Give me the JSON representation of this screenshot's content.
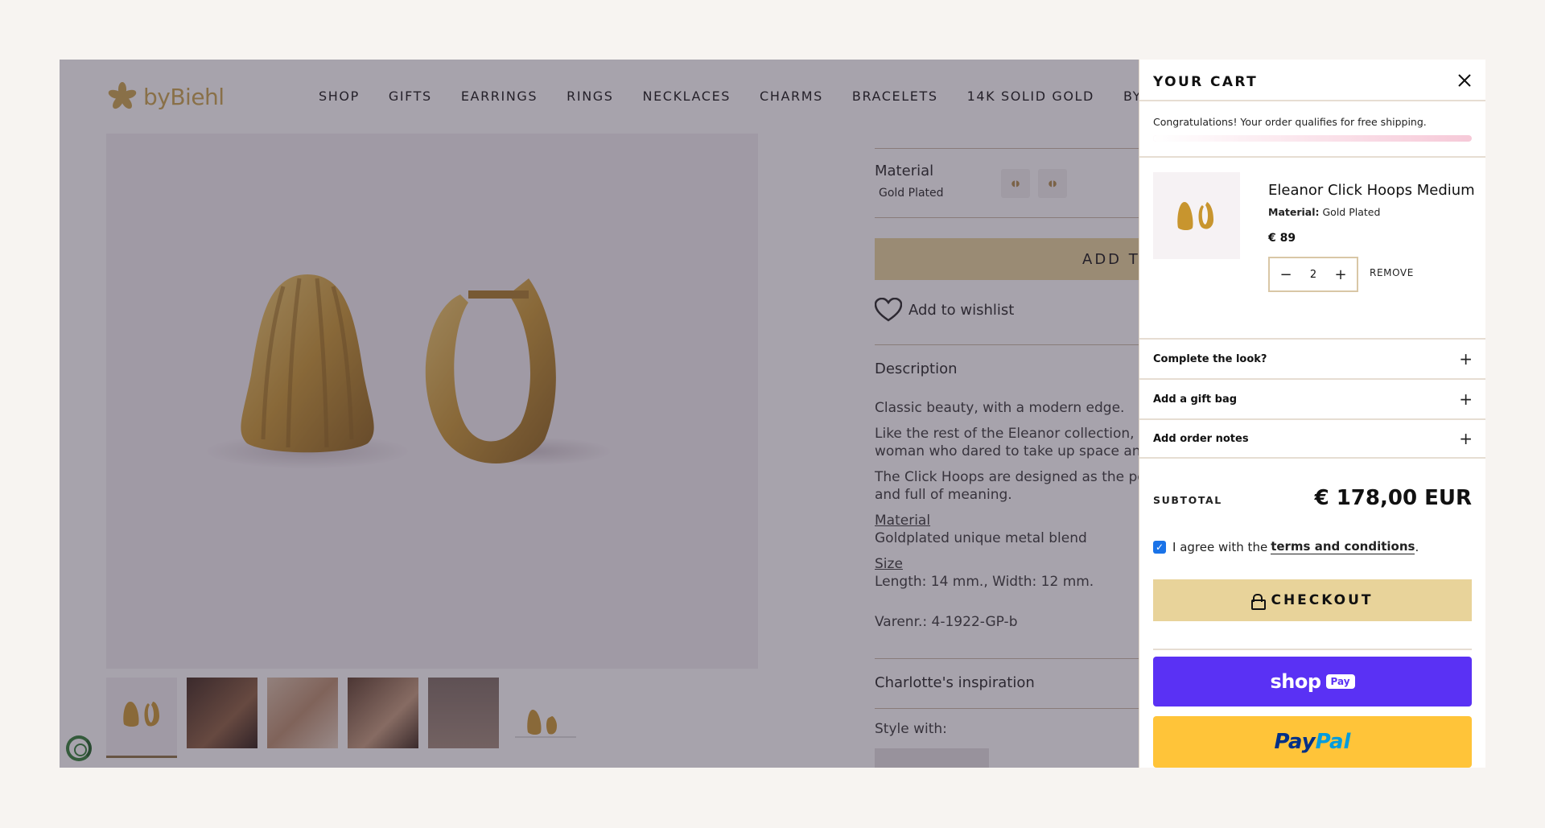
{
  "header": {
    "logo_text": "byBiehl",
    "nav": [
      "SHOP",
      "GIFTS",
      "EARRINGS",
      "RINGS",
      "NECKLACES",
      "CHARMS",
      "BRACELETS",
      "14K SOLID GOLD",
      "BYBIEHL U"
    ]
  },
  "product": {
    "material_label": "Material",
    "material_value": "Gold Plated",
    "add_to_cart_label": "ADD TO",
    "wishlist_label": "Add to wishlist",
    "description_title": "Description",
    "description": [
      "Classic beauty, with a modern edge.",
      "Like the rest of the Eleanor collection, the",
      "woman who dared to take up space and u",
      "The Click Hoops are designed as the perfe",
      "and full of meaning."
    ],
    "material_heading": "Material",
    "material_text": "Goldplated unique metal blend",
    "size_heading": "Size",
    "size_text": "Length: 14 mm., Width: 12 mm.",
    "sku": "Varenr.: 4-1922-GP-b",
    "inspiration_title": "Charlotte's inspiration",
    "style_with": "Style with:"
  },
  "cart": {
    "title": "YOUR CART",
    "shipping_message": "Congratulations! Your order qualifies for free shipping.",
    "shipping_progress": 1.0,
    "item": {
      "name": "Eleanor Click Hoops Medium",
      "material_label": "Material:",
      "material_value": "Gold Plated",
      "price": "€ 89",
      "quantity": "2",
      "remove_label": "REMOVE"
    },
    "accordions": [
      "Complete the look?",
      "Add a gift bag",
      "Add order notes"
    ],
    "subtotal_label": "SUBTOTAL",
    "subtotal_value": "€ 178,00 EUR",
    "terms_prefix": "I agree with the",
    "terms_link": "terms and conditions",
    "terms_suffix": ".",
    "terms_checked": true,
    "checkout_label": "CHECKOUT",
    "shoppay_text": "shop",
    "shoppay_badge": "Pay",
    "paypal_part1": "Pay",
    "paypal_part2": "Pal"
  },
  "icons": {
    "close": "close-icon",
    "lock": "lock-icon",
    "heart": "heart-icon",
    "plus": "plus-icon",
    "minus": "minus-icon"
  },
  "colors": {
    "accent": "#e8d39a",
    "logo": "#c8a24a",
    "shoppay": "#5a31f4",
    "paypal": "#ffc439",
    "overlay": "#3c3246"
  }
}
